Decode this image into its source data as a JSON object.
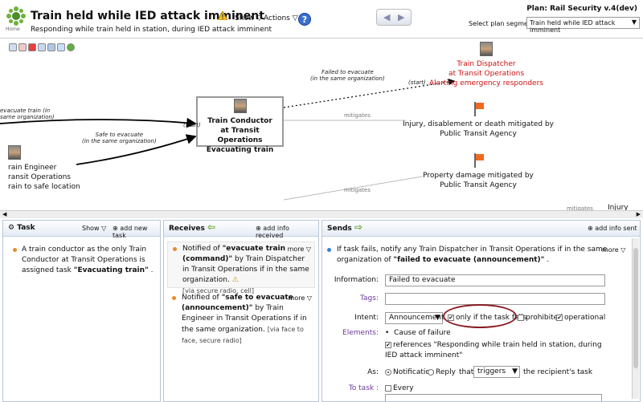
{
  "header": {
    "home_label": "Home",
    "title": "Train held while IED attack imminent",
    "subtitle": "Responding while train held in station, during IED attack imminent",
    "menus": [
      "Show",
      "Actions"
    ],
    "help": "?",
    "plan": "Plan: Rail Security v.4(dev)",
    "segment_label": "Select plan segment:",
    "segment_value": "Train held while IED attack imminent"
  },
  "map": {
    "dispatcher": [
      "Train Dispatcher",
      "at Transit Operations",
      "Alerting emergency responders"
    ],
    "conductor": [
      "Train Conductor",
      "at Transit Operations",
      "Evacuating train"
    ],
    "engineer": [
      "rain Engineer",
      "ransit Operations",
      "rain to safe location"
    ],
    "risk1": [
      "Injury, disablement or death mitigated by",
      "Public Transit Agency"
    ],
    "risk2": [
      "Property damage mitigated by",
      "Public Transit Agency"
    ],
    "edge_failed": [
      "Failed to evacuate",
      "(in the same organization)"
    ],
    "edge_safe": [
      "Safe to evacuate",
      "(in the same organization)"
    ],
    "edge_evacuate": [
      "evacuate train (in",
      "same organization)"
    ],
    "start1": "(start)",
    "start2": "(start)",
    "mitigates1": "mitigates",
    "mitigates2": "mitigates",
    "mitigates3": "mitigates",
    "injury_cut": "Injury"
  },
  "task": {
    "title": "Task",
    "show": "Show",
    "add": "add new task",
    "text": "A train conductor as the only Train Conductor at Transit Operations is assigned task",
    "task_name": "\"Evacuating train\"",
    "suffix": "."
  },
  "receives": {
    "title": "Receives",
    "add": "add info received",
    "items": [
      {
        "more": "more",
        "prefix": "Notified of",
        "name": "\"evacuate train (command)\"",
        "rest": "by Train Dispatcher in Transit Operations if in the same organization.",
        "via": "[via secure radio, cell]"
      },
      {
        "more": "more",
        "prefix": "Notified of",
        "name": "\"safe to evacuate (announcement)\"",
        "rest": "by Train Engineer in Transit Operations if in the same organization.",
        "via": "[via face to face, secure radio]"
      }
    ]
  },
  "sends": {
    "title": "Sends",
    "add": "add info sent",
    "more": "more",
    "summary": "If task fails, notify any Train Dispatcher in Transit Operations if in the same organization of",
    "summary_name": "\"failed to evacuate (announcement)\"",
    "summary_end": ".",
    "information_label": "Information:",
    "information_value": "Failed to evacuate",
    "tags_label": "Tags:",
    "tags_value": "",
    "intent_label": "Intent:",
    "intent_value": "Announcement",
    "only_if_fails": "only if the task fails",
    "prohibited": "prohibited",
    "operational": "operational",
    "elements_label": "Elements:",
    "element_item": "Cause of failure",
    "references": "references \"Responding while train held in station, during IED attack imminent\"",
    "as_label": "As:",
    "notification": "Notification",
    "reply": "Reply",
    "that": "that",
    "triggers": "triggers",
    "recipient": "the recipient's task",
    "totask_label": "To task :",
    "every": "Every"
  }
}
